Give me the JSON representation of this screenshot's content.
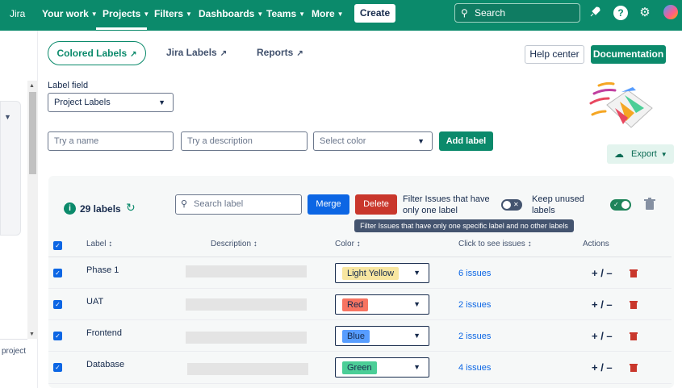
{
  "topnav": {
    "brand": "Jira",
    "items": [
      "Your work",
      "Projects",
      "Filters",
      "Dashboards",
      "Teams",
      "More"
    ],
    "create_label": "Create",
    "search_placeholder": "Search",
    "bg_color": "#0b8a6b",
    "icons": [
      "rocket-icon",
      "help-icon",
      "gear-icon",
      "avatar"
    ]
  },
  "left": {
    "project_text": "project"
  },
  "tabs": {
    "colored_labels": "Colored Labels",
    "jira_labels": "Jira Labels",
    "reports": "Reports"
  },
  "header_buttons": {
    "help": "Help center",
    "documentation": "Documentation"
  },
  "form": {
    "label_field_title": "Label field",
    "label_field_value": "Project Labels",
    "name_placeholder": "Try a name",
    "description_placeholder": "Try a description",
    "color_placeholder": "Select color",
    "add_label": "Add label",
    "export": "Export"
  },
  "panel": {
    "count_badge": "i",
    "count_text": "29 labels",
    "search_placeholder": "Search label",
    "merge": "Merge",
    "delete": "Delete",
    "filter_toggle_label": "Filter Issues that have only one label",
    "filter_toggle_on": false,
    "keep_unused_label": "Keep unused labels",
    "keep_unused_on": true,
    "tooltip": "Filter Issues that have only one specific label and no other labels"
  },
  "table": {
    "headers": {
      "label": "Label ↕",
      "description": "Description ↕",
      "color": "Color ↕",
      "issues": "Click to see issues ↕",
      "actions": "Actions"
    },
    "rows": [
      {
        "name": "Phase 1",
        "color_name": "Light Yellow",
        "color_hex": "#f8e6a0",
        "issues": "6 issues",
        "checked": true
      },
      {
        "name": "UAT",
        "color_name": "Red",
        "color_hex": "#f87462",
        "issues": "2 issues",
        "checked": true
      },
      {
        "name": "Frontend",
        "color_name": "Blue",
        "color_hex": "#579dff",
        "issues": "2 issues",
        "checked": true
      },
      {
        "name": "Database",
        "color_name": "Green",
        "color_hex": "#4bce97",
        "issues": "4 issues",
        "checked": true
      }
    ],
    "actions_text": "+ / –"
  }
}
